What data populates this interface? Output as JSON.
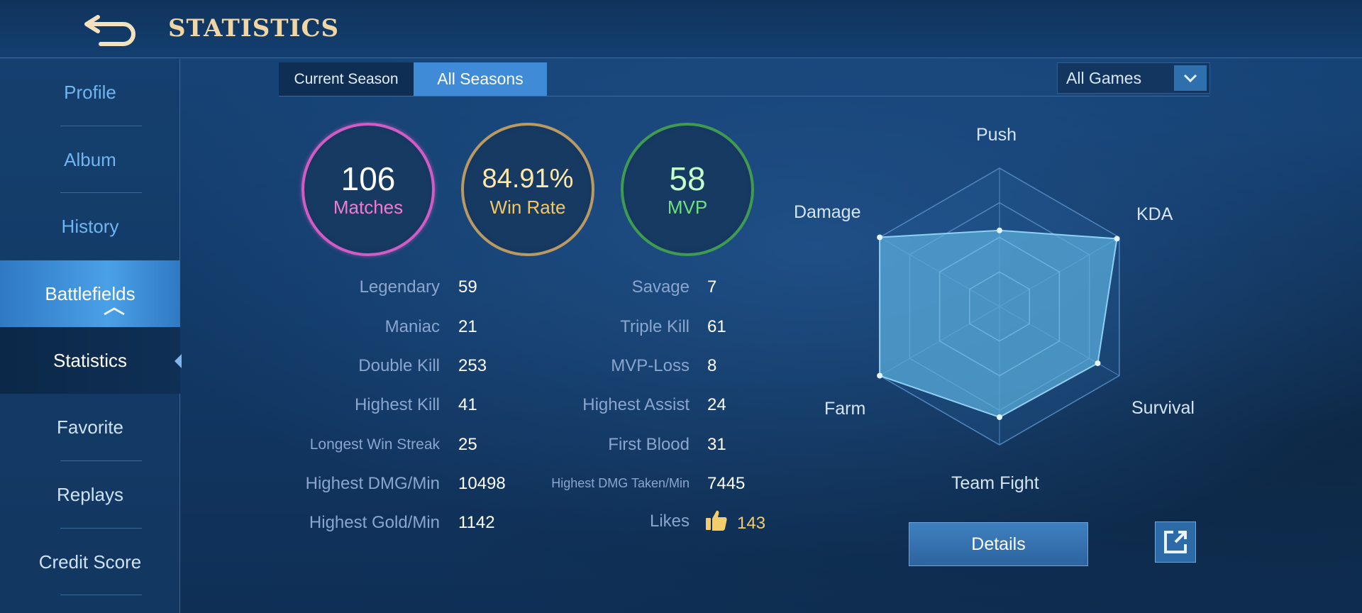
{
  "header": {
    "title": "STATISTICS",
    "back_icon": "back-arrow-icon"
  },
  "sidebar": {
    "items": [
      {
        "label": "Profile"
      },
      {
        "label": "Album"
      },
      {
        "label": "History"
      },
      {
        "label": "Battlefields"
      },
      {
        "label": "Statistics"
      },
      {
        "label": "Favorite"
      },
      {
        "label": "Replays"
      },
      {
        "label": "Credit Score"
      }
    ],
    "active_group": "Battlefields",
    "selected": "Statistics"
  },
  "tabs": [
    {
      "label": "Current Season",
      "active": false
    },
    {
      "label": "All Seasons",
      "active": true
    }
  ],
  "filter": {
    "selected": "All Games"
  },
  "summary": {
    "matches": {
      "value": "106",
      "label": "Matches"
    },
    "win_rate": {
      "value": "84.91%",
      "label": "Win Rate"
    },
    "mvp": {
      "value": "58",
      "label": "MVP"
    }
  },
  "stats_left": [
    {
      "label": "Legendary",
      "value": "59"
    },
    {
      "label": "Maniac",
      "value": "21"
    },
    {
      "label": "Double Kill",
      "value": "253"
    },
    {
      "label": "Highest Kill",
      "value": "41"
    },
    {
      "label": "Longest Win Streak",
      "value": "25"
    },
    {
      "label": "Highest DMG/Min",
      "value": "10498"
    },
    {
      "label": "Highest Gold/Min",
      "value": "1142"
    }
  ],
  "stats_right": [
    {
      "label": "Savage",
      "value": "7"
    },
    {
      "label": "Triple Kill",
      "value": "61"
    },
    {
      "label": "MVP-Loss",
      "value": "8"
    },
    {
      "label": "Highest Assist",
      "value": "24"
    },
    {
      "label": "First Blood",
      "value": "31"
    },
    {
      "label": "Highest DMG Taken/Min",
      "value": "7445"
    },
    {
      "label": "Likes",
      "value": "143"
    }
  ],
  "radar": {
    "axes": [
      "Push",
      "KDA",
      "Survival",
      "Team Fight",
      "Farm",
      "Damage"
    ],
    "values": [
      0.55,
      0.98,
      0.82,
      0.8,
      1.0,
      1.0
    ],
    "fill_color": "#5aaedc"
  },
  "buttons": {
    "details": "Details",
    "share_icon": "share-external-icon"
  },
  "colors": {
    "matches_ring": "#d05cc4",
    "winrate_ring": "#b89a62",
    "mvp_ring": "#3f9a52",
    "title_gold": "#f0d6a6",
    "likes_gold": "#f3cc6e"
  }
}
